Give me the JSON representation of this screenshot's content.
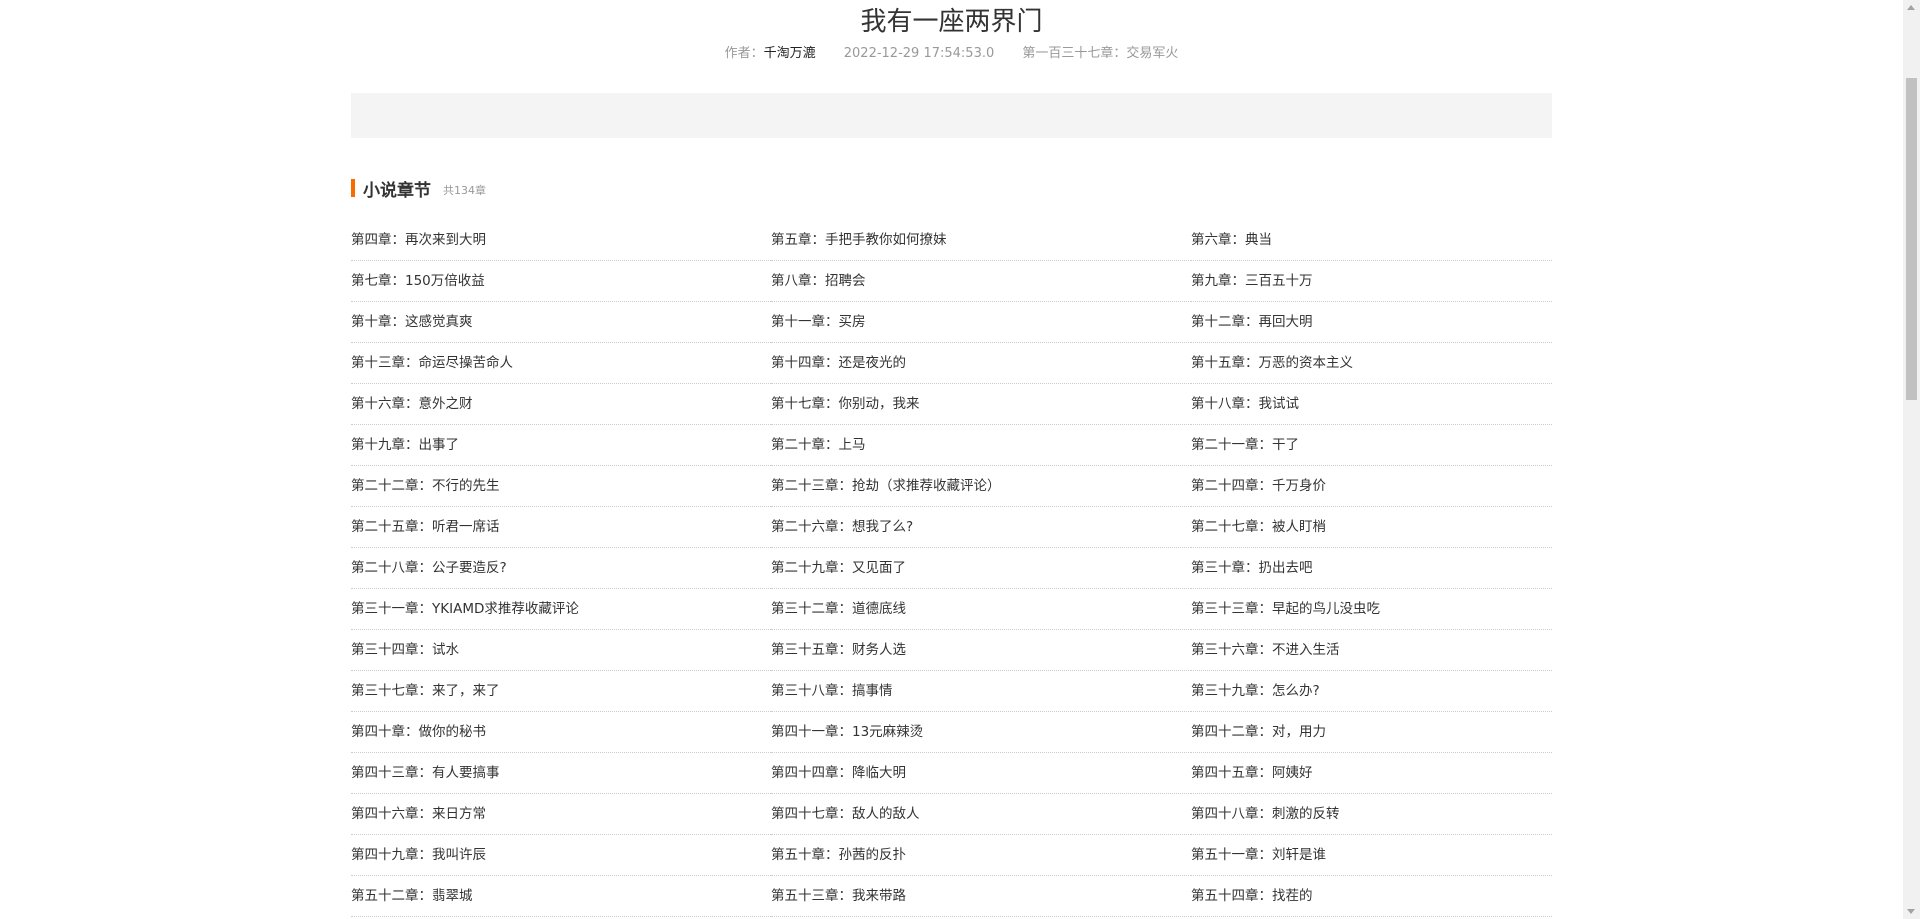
{
  "book": {
    "title": "我有一座两界门",
    "author_label": "作者：",
    "author": "千淘万漉",
    "updated": "2022-12-29 17:54:53.0",
    "latest_chapter": "第一百三十七章：交易军火"
  },
  "section": {
    "title": "小说章节",
    "count": "共134章"
  },
  "chapters": [
    "第四章：再次来到大明",
    "第五章：手把手教你如何撩妹",
    "第六章：典当",
    "第七章：150万倍收益",
    "第八章：招聘会",
    "第九章：三百五十万",
    "第十章：这感觉真爽",
    "第十一章：买房",
    "第十二章：再回大明",
    "第十三章：命运尽操苦命人",
    "第十四章：还是夜光的",
    "第十五章：万恶的资本主义",
    "第十六章：意外之财",
    "第十七章：你别动，我来",
    "第十八章：我试试",
    "第十九章：出事了",
    "第二十章：上马",
    "第二十一章：干了",
    "第二十二章：不行的先生",
    "第二十三章：抢劫（求推荐收藏评论）",
    "第二十四章：千万身价",
    "第二十五章：听君一席话",
    "第二十六章：想我了么?",
    "第二十七章：被人盯梢",
    "第二十八章：公子要造反?",
    "第二十九章：又见面了",
    "第三十章：扔出去吧",
    "第三十一章：YKIAMD求推荐收藏评论",
    "第三十二章：道德底线",
    "第三十三章：早起的鸟儿没虫吃",
    "第三十四章：试水",
    "第三十五章：财务人选",
    "第三十六章：不进入生活",
    "第三十七章：来了，来了",
    "第三十八章：搞事情",
    "第三十九章：怎么办?",
    "第四十章：做你的秘书",
    "第四十一章：13元麻辣烫",
    "第四十二章：对，用力",
    "第四十三章：有人要搞事",
    "第四十四章：降临大明",
    "第四十五章：阿姨好",
    "第四十六章：来日方常",
    "第四十七章：敌人的敌人",
    "第四十八章：刺激的反转",
    "第四十九章：我叫许辰",
    "第五十章：孙茜的反扑",
    "第五十一章：刘轩是谁",
    "第五十二章：翡翠城",
    "第五十三章：我来带路",
    "第五十四章：找茬的"
  ],
  "colors": {
    "accent": "#f56c00",
    "banner": "#f4f4f4"
  }
}
